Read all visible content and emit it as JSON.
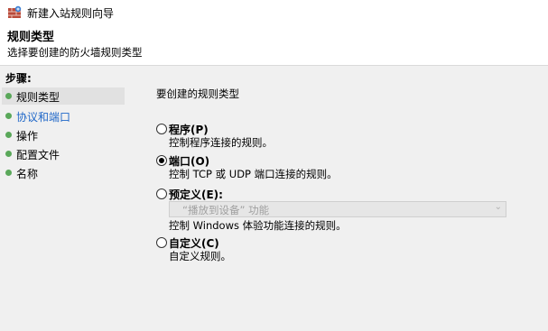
{
  "window": {
    "title": "新建入站规则向导"
  },
  "header": {
    "title": "规则类型",
    "subtitle": "选择要创建的防火墙规则类型"
  },
  "sidebar": {
    "title": "步骤:",
    "steps": [
      {
        "label": "规则类型"
      },
      {
        "label": "协议和端口"
      },
      {
        "label": "操作"
      },
      {
        "label": "配置文件"
      },
      {
        "label": "名称"
      }
    ]
  },
  "main": {
    "prompt": "要创建的规则类型",
    "options": [
      {
        "label": "程序(P)",
        "desc": "控制程序连接的规则。",
        "checked": false
      },
      {
        "label": "端口(O)",
        "desc": "控制 TCP 或 UDP 端口连接的规则。",
        "checked": true
      },
      {
        "label": "预定义(E):",
        "select_value": "“播放到设备” 功能",
        "desc": "控制 Windows 体验功能连接的规则。",
        "checked": false
      },
      {
        "label": "自定义(C)",
        "desc": "自定义规则。",
        "checked": false
      }
    ]
  },
  "colors": {
    "link": "#1f67c8",
    "step_dot": "#5aa85a",
    "panel_bg": "#f0f0f0"
  }
}
